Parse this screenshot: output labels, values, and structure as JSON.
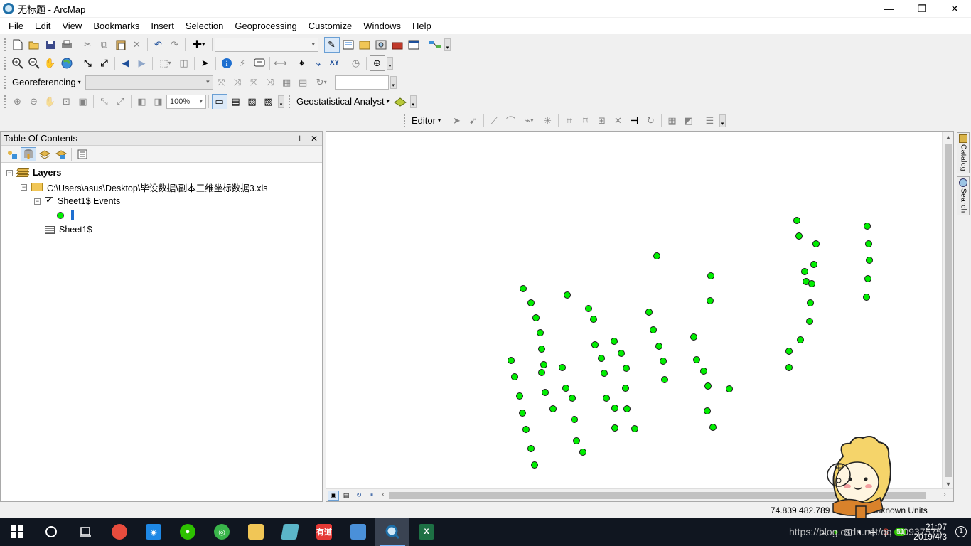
{
  "window": {
    "title": "无标题 - ArcMap",
    "minimize": "—",
    "restore": "❐",
    "close": "✕"
  },
  "menu": [
    "File",
    "Edit",
    "View",
    "Bookmarks",
    "Insert",
    "Selection",
    "Geoprocessing",
    "Customize",
    "Windows",
    "Help"
  ],
  "toolbars": {
    "georeferencing_label": "Georeferencing",
    "zoom_combo": "100%",
    "geostat_label": "Geostatistical Analyst",
    "editor_label": "Editor"
  },
  "icons": {
    "standard": [
      "new-document-icon",
      "open-icon",
      "save-icon",
      "print-icon",
      "cut-icon",
      "copy-icon",
      "paste-icon",
      "delete-icon",
      "undo-icon",
      "redo-icon",
      "add-data-icon",
      "editor-toolbar-icon",
      "table-of-contents-icon",
      "catalog-icon",
      "search-icon",
      "arctoolbox-icon",
      "python-icon",
      "model-builder-icon"
    ],
    "tools": [
      "zoom-in-icon",
      "zoom-out-icon",
      "pan-icon",
      "full-extent-icon",
      "fixed-zoom-in-icon",
      "fixed-zoom-out-icon",
      "back-icon",
      "forward-icon",
      "select-features-icon",
      "clear-selection-icon",
      "select-elements-icon",
      "identify-icon",
      "hyperlink-icon",
      "html-popup-icon",
      "measure-icon",
      "find-icon",
      "find-route-icon",
      "go-to-xy-icon",
      "time-slider-icon",
      "viewer-window-icon"
    ]
  },
  "toc": {
    "title": "Table Of Contents",
    "pin": "⊥",
    "close": "✕",
    "tools": [
      "list-by-drawing-order-icon",
      "list-by-source-icon",
      "list-by-visibility-icon",
      "list-by-selection-icon",
      "options-icon"
    ],
    "root": "Layers",
    "source_path": "C:\\Users\\asus\\Desktop\\毕设数据\\副本三维坐标数据3.xls",
    "layer": "Sheet1$ Events",
    "table": "Sheet1$",
    "layer_checked": true
  },
  "map": {
    "point_color": "#00ee00",
    "points": [
      [
        1121,
        310
      ],
      [
        1220,
        318
      ],
      [
        1124,
        332
      ],
      [
        1148,
        343
      ],
      [
        1222,
        343
      ],
      [
        924,
        360
      ],
      [
        1145,
        372
      ],
      [
        1223,
        366
      ],
      [
        1132,
        382
      ],
      [
        1000,
        388
      ],
      [
        1134,
        396
      ],
      [
        1142,
        399
      ],
      [
        1221,
        392
      ],
      [
        736,
        406
      ],
      [
        798,
        415
      ],
      [
        1219,
        418
      ],
      [
        999,
        423
      ],
      [
        747,
        426
      ],
      [
        828,
        434
      ],
      [
        1140,
        426
      ],
      [
        913,
        439
      ],
      [
        754,
        447
      ],
      [
        835,
        449
      ],
      [
        1139,
        452
      ],
      [
        919,
        464
      ],
      [
        760,
        468
      ],
      [
        976,
        474
      ],
      [
        864,
        480
      ],
      [
        1126,
        478
      ],
      [
        837,
        485
      ],
      [
        927,
        487
      ],
      [
        762,
        491
      ],
      [
        874,
        497
      ],
      [
        1110,
        494
      ],
      [
        719,
        507
      ],
      [
        846,
        504
      ],
      [
        933,
        508
      ],
      [
        980,
        506
      ],
      [
        765,
        513
      ],
      [
        791,
        517
      ],
      [
        881,
        518
      ],
      [
        762,
        524
      ],
      [
        850,
        525
      ],
      [
        990,
        522
      ],
      [
        724,
        530
      ],
      [
        935,
        534
      ],
      [
        796,
        546
      ],
      [
        880,
        546
      ],
      [
        996,
        543
      ],
      [
        767,
        552
      ],
      [
        1026,
        547
      ],
      [
        731,
        557
      ],
      [
        805,
        560
      ],
      [
        853,
        560
      ],
      [
        1110,
        517
      ],
      [
        778,
        575
      ],
      [
        865,
        574
      ],
      [
        882,
        575
      ],
      [
        735,
        581
      ],
      [
        995,
        578
      ],
      [
        808,
        590
      ],
      [
        740,
        604
      ],
      [
        865,
        602
      ],
      [
        893,
        603
      ],
      [
        1003,
        601
      ],
      [
        811,
        620
      ],
      [
        747,
        631
      ],
      [
        820,
        636
      ],
      [
        752,
        654
      ]
    ]
  },
  "side_tabs": [
    "Catalog",
    "Search"
  ],
  "status": {
    "coords": "74.839   482.789",
    "units": "Unknown Units"
  },
  "taskbar": {
    "apps": [
      "start-icon",
      "cortana-icon",
      "task-view-icon",
      "paint-app-icon",
      "qq-icon",
      "wechat-icon",
      "browser-icon",
      "file-explorer-icon",
      "notebook-icon",
      "youdao-icon",
      "control-panel-icon",
      "arcmap-icon",
      "excel-icon"
    ],
    "active_app": "arcmap-icon",
    "youdao_text": "有道",
    "excel_text": "X",
    "tray_label": "中",
    "battery_pct": "51",
    "time": "21:07",
    "date": "2019/4/3",
    "notification_count": "1",
    "watermark": "https://blog.csdn.net/qq_40937575"
  }
}
